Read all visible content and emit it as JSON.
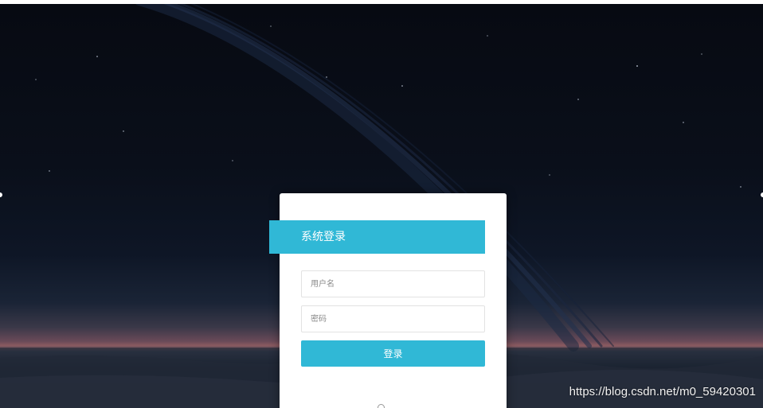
{
  "login": {
    "title": "系统登录",
    "username_placeholder": "用户名",
    "password_placeholder": "密码",
    "submit_label": "登录"
  },
  "watermark": {
    "text": "https://blog.csdn.net/m0_59420301"
  },
  "colors": {
    "accent": "#30b8d6",
    "card_background": "#ffffff",
    "page_background": "#0b0f18"
  },
  "icons": {
    "footer": "circle-icon"
  }
}
